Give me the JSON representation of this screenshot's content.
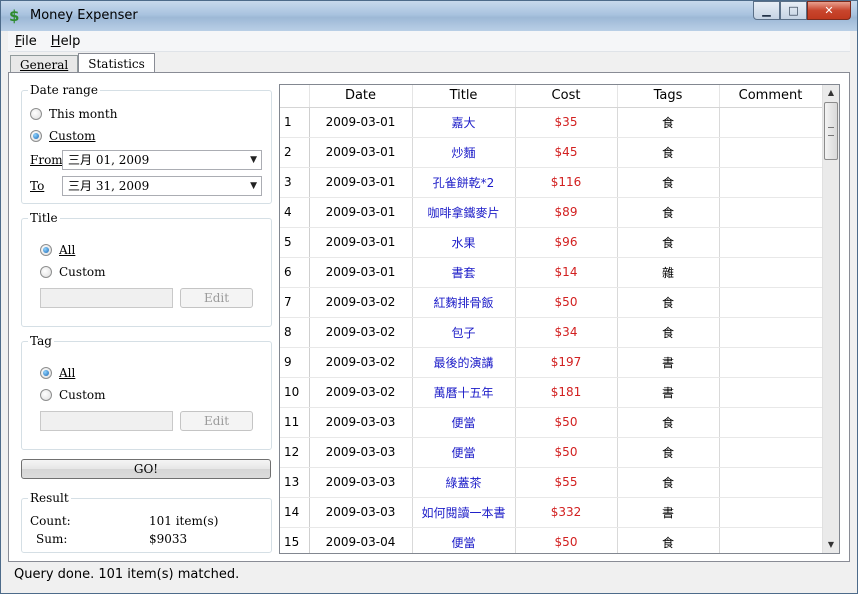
{
  "window": {
    "title": "Money Expenser",
    "minimize": "▁",
    "maximize": "□",
    "close": "✕",
    "app_icon": "$"
  },
  "menu": [
    {
      "label_underline": "F",
      "label_rest": "ile"
    },
    {
      "label_underline": "H",
      "label_rest": "elp"
    }
  ],
  "tabs": [
    "General",
    "Statistics"
  ],
  "date_range": {
    "legend": "Date range",
    "this_month": "This month",
    "custom": "Custom",
    "from_label": "From",
    "to_label": "To",
    "from_value": "三月 01, 2009",
    "to_value": "三月 31, 2009"
  },
  "title_group": {
    "legend": "Title",
    "all": "All",
    "custom": "Custom",
    "edit": "Edit"
  },
  "tag_group": {
    "legend": "Tag",
    "all": "All",
    "custom": "Custom",
    "edit": "Edit"
  },
  "go_button": "GO!",
  "result": {
    "legend": "Result",
    "count_label": "Count:",
    "count_value": "101 item(s)",
    "sum_label": "Sum:",
    "sum_value": "$9033"
  },
  "grid": {
    "headers": [
      "Date",
      "Title",
      "Cost",
      "Tags",
      "Comment"
    ],
    "rows": [
      {
        "n": "1",
        "date": "2009-03-01",
        "title": "嘉大",
        "cost": "$35",
        "tag": "食",
        "comment": ""
      },
      {
        "n": "2",
        "date": "2009-03-01",
        "title": "炒麵",
        "cost": "$45",
        "tag": "食",
        "comment": ""
      },
      {
        "n": "3",
        "date": "2009-03-01",
        "title": "孔雀餅乾*2",
        "cost": "$116",
        "tag": "食",
        "comment": ""
      },
      {
        "n": "4",
        "date": "2009-03-01",
        "title": "咖啡拿鐵麥片",
        "cost": "$89",
        "tag": "食",
        "comment": ""
      },
      {
        "n": "5",
        "date": "2009-03-01",
        "title": "水果",
        "cost": "$96",
        "tag": "食",
        "comment": ""
      },
      {
        "n": "6",
        "date": "2009-03-01",
        "title": "書套",
        "cost": "$14",
        "tag": "雜",
        "comment": ""
      },
      {
        "n": "7",
        "date": "2009-03-02",
        "title": "紅麴排骨飯",
        "cost": "$50",
        "tag": "食",
        "comment": ""
      },
      {
        "n": "8",
        "date": "2009-03-02",
        "title": "包子",
        "cost": "$34",
        "tag": "食",
        "comment": ""
      },
      {
        "n": "9",
        "date": "2009-03-02",
        "title": "最後的演講",
        "cost": "$197",
        "tag": "書",
        "comment": ""
      },
      {
        "n": "10",
        "date": "2009-03-02",
        "title": "萬曆十五年",
        "cost": "$181",
        "tag": "書",
        "comment": ""
      },
      {
        "n": "11",
        "date": "2009-03-03",
        "title": "便當",
        "cost": "$50",
        "tag": "食",
        "comment": ""
      },
      {
        "n": "12",
        "date": "2009-03-03",
        "title": "便當",
        "cost": "$50",
        "tag": "食",
        "comment": ""
      },
      {
        "n": "13",
        "date": "2009-03-03",
        "title": "綠蓋茶",
        "cost": "$55",
        "tag": "食",
        "comment": ""
      },
      {
        "n": "14",
        "date": "2009-03-03",
        "title": "如何閱讀一本書",
        "cost": "$332",
        "tag": "書",
        "comment": ""
      },
      {
        "n": "15",
        "date": "2009-03-04",
        "title": "便當",
        "cost": "$50",
        "tag": "食",
        "comment": ""
      }
    ]
  },
  "status": "Query done. 101 item(s) matched."
}
